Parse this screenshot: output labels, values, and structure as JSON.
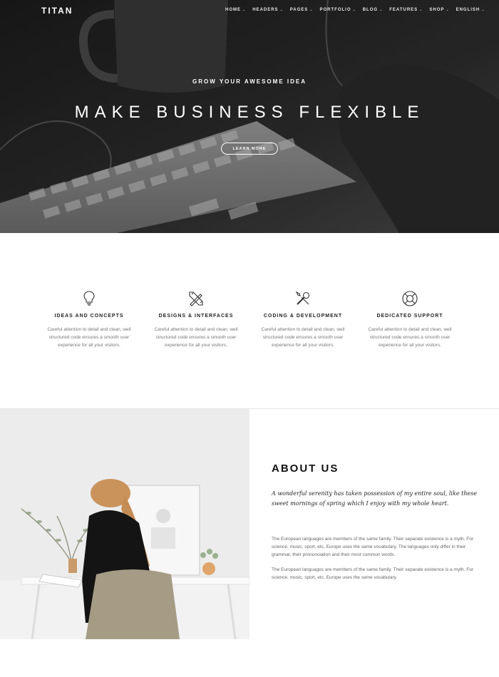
{
  "brand": "TITAN",
  "nav": {
    "items": [
      {
        "label": "HOME",
        "caret": "⌄"
      },
      {
        "label": "HEADERS",
        "caret": "⌄"
      },
      {
        "label": "PAGES",
        "caret": "⌄"
      },
      {
        "label": "PORTFOLIO",
        "caret": "⌄"
      },
      {
        "label": "BLOG",
        "caret": "⌄"
      },
      {
        "label": "FEATURES",
        "caret": "⌄"
      },
      {
        "label": "SHOP",
        "caret": "⌄"
      },
      {
        "label": "ENGLISH",
        "caret": "⌄"
      }
    ]
  },
  "hero": {
    "subtitle": "GROW YOUR AWESOME IDEA",
    "title": "MAKE BUSINESS FLEXIBLE",
    "button": "LEARN MORE"
  },
  "features": [
    {
      "icon": "lightbulb-icon",
      "title": "IDEAS AND CONCEPTS",
      "text": "Careful attention to detail and clean, well structured code ensures a smooth user experience for all your visitors."
    },
    {
      "icon": "design-tools-icon",
      "title": "DESIGNS & INTERFACES",
      "text": "Careful attention to detail and clean, well structured code ensures a smooth user experience for all your visitors."
    },
    {
      "icon": "tools-icon",
      "title": "CODING & DEVELOPMENT",
      "text": "Careful attention to detail and clean, well structured code ensures a smooth user experience for all your visitors."
    },
    {
      "icon": "lifebuoy-icon",
      "title": "DEDICATED SUPPORT",
      "text": "Careful attention to detail and clean, well structured code ensures a smooth user experience for all your visitors."
    }
  ],
  "about": {
    "title": "ABOUT US",
    "lead": "A wonderful serenity has taken possession of my entire soul, like these sweet mornings of spring which I enjoy with my whole heart.",
    "paragraphs": [
      "The European languages are members of the same family. Their separate existence is a myth. For science, music, sport, etc, Europe uses the same vocabulary. The languages only differ in their grammar, their pronunciation and their most common words.",
      "The European languages are members of the same family. Their separate existence is a myth. For science, music, sport, etc, Europe uses the same vocabulary."
    ]
  },
  "colors": {
    "hero_bg": "#262626",
    "text_dark": "#222222",
    "text_muted": "#777777",
    "white": "#ffffff"
  }
}
